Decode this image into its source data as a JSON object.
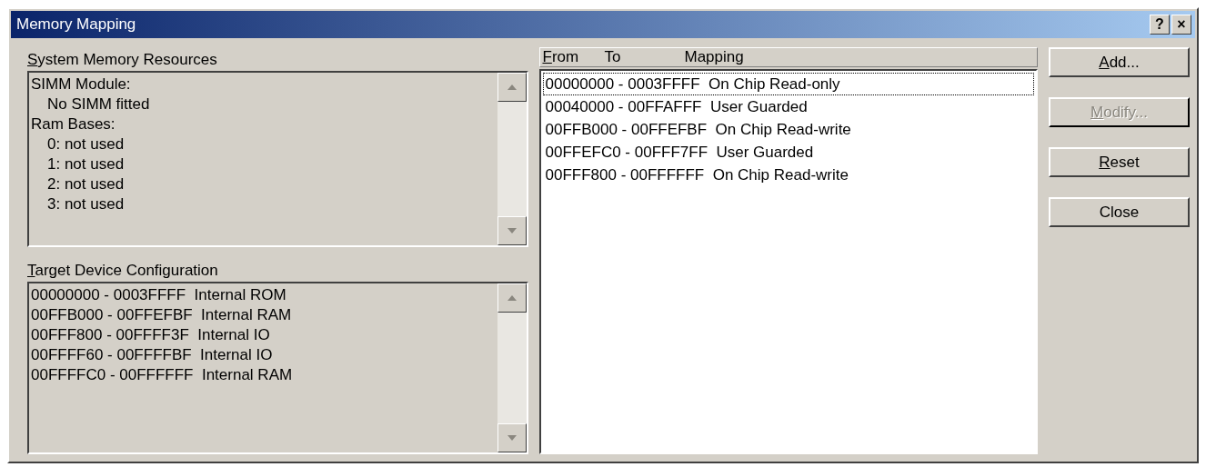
{
  "window": {
    "title": "Memory Mapping",
    "title_buttons": [
      "?",
      "×"
    ]
  },
  "system_memory": {
    "label": [
      {
        "text": "S",
        "underlined": true
      },
      {
        "text": "ystem Memory Resources",
        "underlined": false
      }
    ],
    "groups": [
      {
        "text": "SIMM Module:",
        "children": [
          "No SIMM fitted"
        ]
      },
      {
        "text": "Ram Bases:",
        "children": [
          "0: not used",
          "1: not used",
          "2: not used",
          "3: not used"
        ]
      }
    ]
  },
  "target_device": {
    "label": [
      {
        "text": "T",
        "underlined": true
      },
      {
        "text": "arget Device Configuration",
        "underlined": false
      }
    ],
    "lines": [
      "00000000 - 0003FFFF  Internal ROM",
      "00FFB000 - 00FFEFBF  Internal RAM",
      "00FFF800 - 00FFFF3F  Internal IO",
      "00FFFF60 - 00FFFFBF  Internal IO",
      "00FFFFC0 - 00FFFFFF  Internal RAM"
    ]
  },
  "mapping": {
    "columns": [
      {
        "label": [
          {
            "text": "F",
            "underlined": true
          },
          {
            "text": "rom",
            "underlined": false
          }
        ]
      },
      {
        "label": [
          {
            "text": "To",
            "underlined": false
          }
        ]
      },
      {
        "label": [
          {
            "text": "Mapping",
            "underlined": false
          }
        ]
      }
    ],
    "rows": [
      {
        "text": "00000000 - 0003FFFF  On Chip Read-only",
        "selected": true
      },
      {
        "text": "00040000 - 00FFAFFF  User Guarded",
        "selected": false
      },
      {
        "text": "00FFB000 - 00FFEFBF  On Chip Read-write",
        "selected": false
      },
      {
        "text": "00FFEFC0 - 00FFF7FF  User Guarded",
        "selected": false
      },
      {
        "text": "00FFF800 - 00FFFFFF  On Chip Read-write",
        "selected": false
      }
    ]
  },
  "buttons": [
    {
      "label": [
        {
          "text": "A",
          "underlined": true
        },
        {
          "text": "dd...",
          "underlined": false
        }
      ],
      "disabled": false
    },
    {
      "label": [
        {
          "text": "M",
          "underlined": true
        },
        {
          "text": "odify...",
          "underlined": false
        }
      ],
      "disabled": true
    },
    {
      "label": [
        {
          "text": "R",
          "underlined": true
        },
        {
          "text": "eset",
          "underlined": false
        }
      ],
      "disabled": false
    },
    {
      "label": [
        {
          "text": "Close",
          "underlined": false
        }
      ],
      "disabled": false
    }
  ]
}
